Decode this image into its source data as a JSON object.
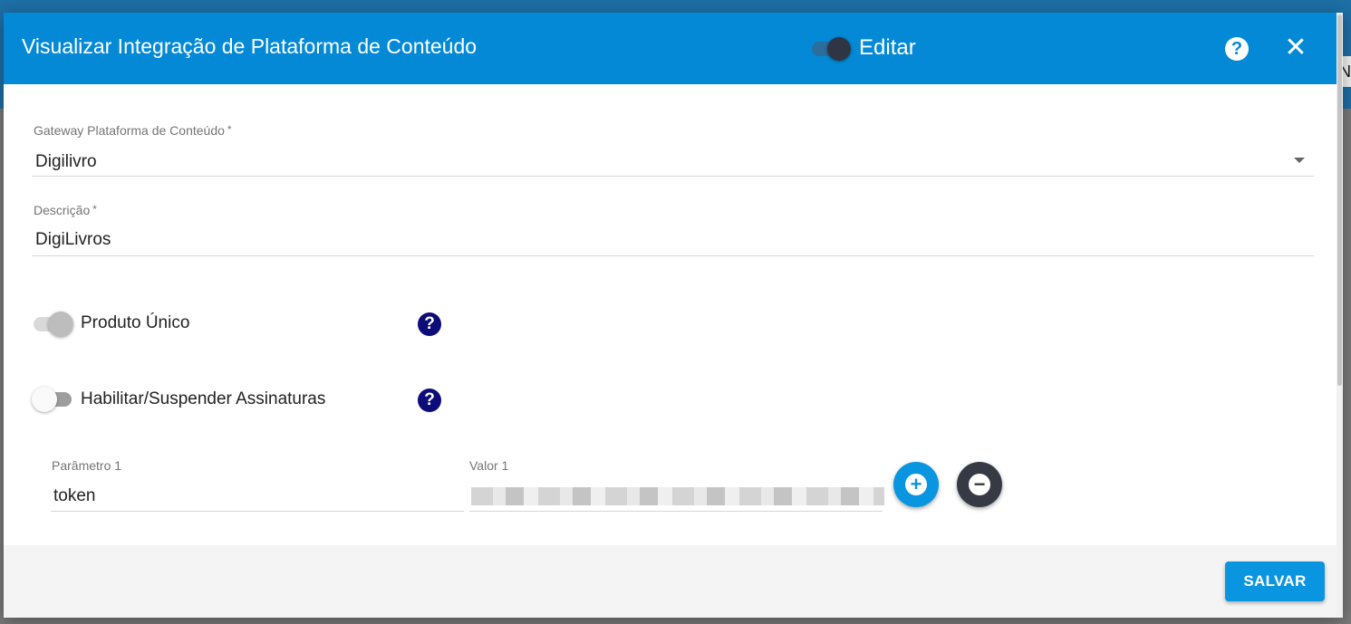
{
  "modal": {
    "title": "Visualizar Integração de Plataforma de Conteúdo",
    "edit_label": "Editar",
    "help_icon": "?",
    "close_icon": "✕"
  },
  "form": {
    "gateway": {
      "label": "Gateway Plataforma de Conteúdo",
      "required": "*",
      "value": "Digilivro"
    },
    "descricao": {
      "label": "Descrição",
      "required": "*",
      "value": "DigiLivros"
    },
    "produto_unico": {
      "label": "Produto Único",
      "help": "?"
    },
    "assinaturas": {
      "label": "Habilitar/Suspender Assinaturas",
      "help": "?"
    },
    "parametro": {
      "label": "Parâmetro 1",
      "value": "token"
    },
    "valor": {
      "label": "Valor 1"
    }
  },
  "buttons": {
    "add_symbol": "+",
    "remove_symbol": "−",
    "save_label": "SALVAR"
  },
  "backdrop": {
    "chip_text": "N"
  },
  "colors": {
    "header": "#0489d6",
    "accent": "#0a95e0",
    "help_dark": "#0d0d7a",
    "remove_button": "#353a44"
  }
}
